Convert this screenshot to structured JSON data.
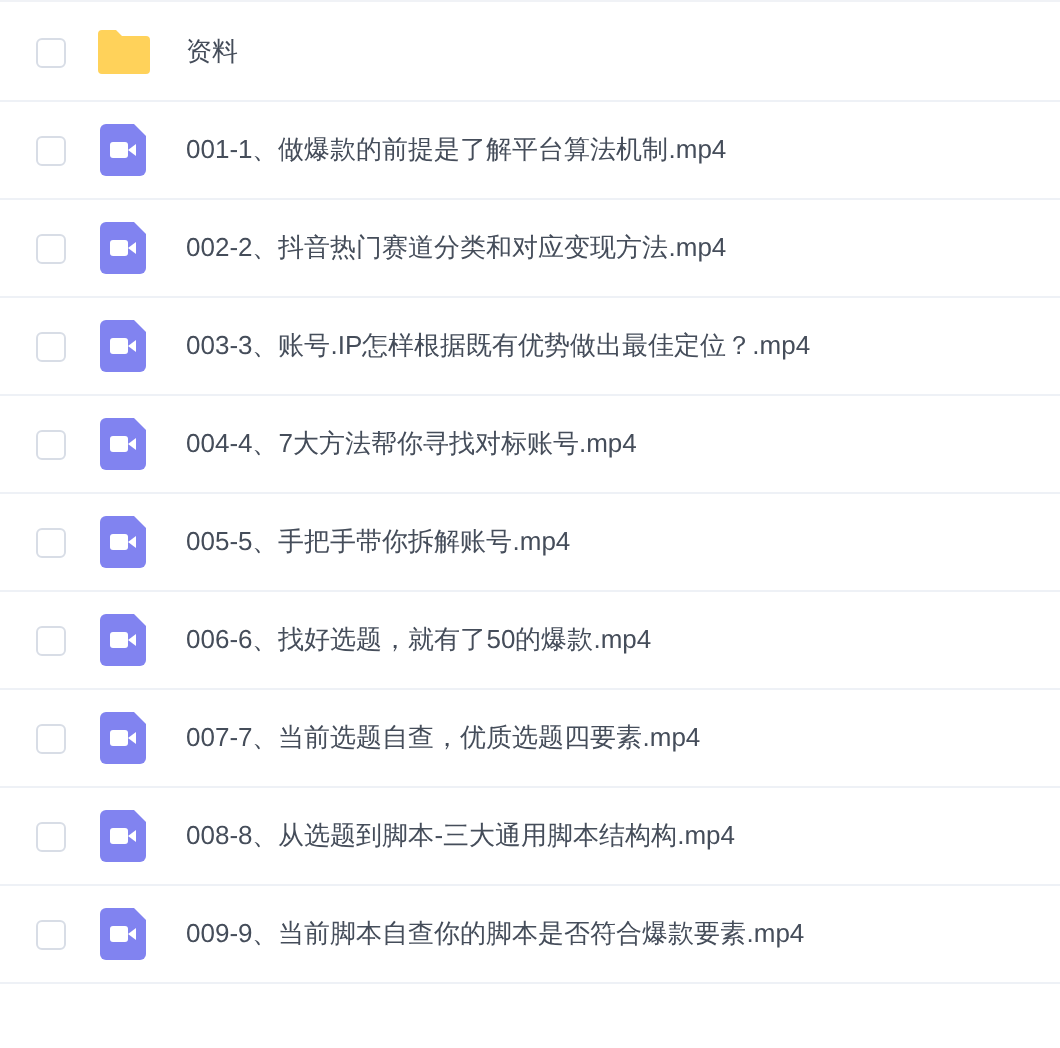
{
  "files": [
    {
      "kind": "folder",
      "name": "资料",
      "checked": false
    },
    {
      "kind": "video",
      "name": "001-1、做爆款的前提是了解平台算法机制.mp4",
      "checked": false
    },
    {
      "kind": "video",
      "name": "002-2、抖音热门赛道分类和对应变现方法.mp4",
      "checked": false
    },
    {
      "kind": "video",
      "name": "003-3、账号.IP怎样根据既有优势做出最佳定位？.mp4",
      "checked": false
    },
    {
      "kind": "video",
      "name": "004-4、7大方法帮你寻找对标账号.mp4",
      "checked": false
    },
    {
      "kind": "video",
      "name": "005-5、手把手带你拆解账号.mp4",
      "checked": false
    },
    {
      "kind": "video",
      "name": "006-6、找好选题，就有了50的爆款.mp4",
      "checked": false
    },
    {
      "kind": "video",
      "name": "007-7、当前选题自查，优质选题四要素.mp4",
      "checked": false
    },
    {
      "kind": "video",
      "name": "008-8、从选题到脚本-三大通用脚本结构构.mp4",
      "checked": false
    },
    {
      "kind": "video",
      "name": "009-9、当前脚本自查你的脚本是否符合爆款要素.mp4",
      "checked": false
    }
  ]
}
